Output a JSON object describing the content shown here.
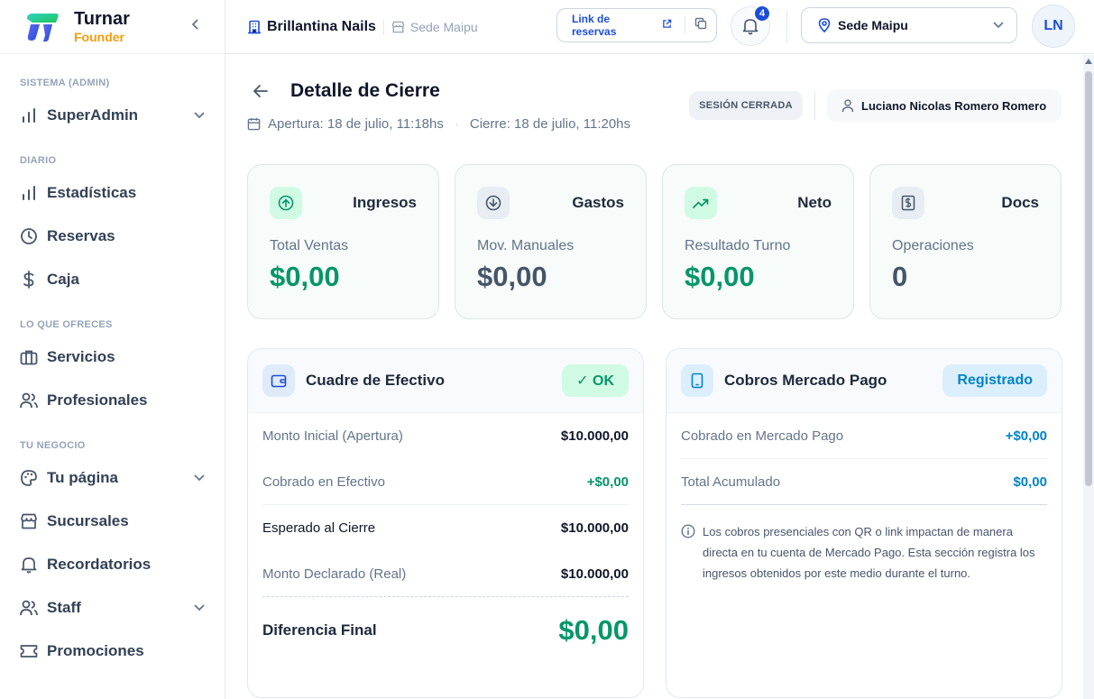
{
  "brand": {
    "name": "Turnar",
    "role": "Founder"
  },
  "sidebar": {
    "sections": [
      {
        "title": "SISTEMA (ADMIN)",
        "items": [
          {
            "label": "SuperAdmin",
            "icon": "bar-chart-icon",
            "expandable": true
          }
        ]
      },
      {
        "title": "DIARIO",
        "items": [
          {
            "label": "Estadísticas",
            "icon": "bar-chart-icon"
          },
          {
            "label": "Reservas",
            "icon": "clock-icon"
          },
          {
            "label": "Caja",
            "icon": "dollar-icon"
          }
        ]
      },
      {
        "title": "LO QUE OFRECES",
        "items": [
          {
            "label": "Servicios",
            "icon": "briefcase-icon"
          },
          {
            "label": "Profesionales",
            "icon": "users-icon"
          }
        ]
      },
      {
        "title": "TU NEGOCIO",
        "items": [
          {
            "label": "Tu página",
            "icon": "palette-icon",
            "expandable": true
          },
          {
            "label": "Sucursales",
            "icon": "store-icon"
          },
          {
            "label": "Recordatorios",
            "icon": "bell-icon"
          },
          {
            "label": "Staff",
            "icon": "users-icon",
            "expandable": true
          },
          {
            "label": "Promociones",
            "icon": "ticket-icon"
          }
        ]
      }
    ]
  },
  "topbar": {
    "business": "Brillantina Nails",
    "branch": "Sede Maipu",
    "booking_link": "Link de reservas",
    "notifications": "4",
    "selected_branch": "Sede Maipu",
    "avatar": "LN"
  },
  "page": {
    "title": "Detalle de Cierre",
    "opening": "Apertura: 18 de julio, 11:18hs",
    "closing": "Cierre: 18 de julio, 11:20hs",
    "status": "SESIÓN CERRADA",
    "user": "Luciano Nicolas Romero Romero"
  },
  "stats": [
    {
      "name": "Ingresos",
      "label": "Total Ventas",
      "value": "$0,00",
      "icon": "arrow-up-circle-icon",
      "color": "#059669"
    },
    {
      "name": "Gastos",
      "label": "Mov. Manuales",
      "value": "$0,00",
      "icon": "arrow-down-circle-icon",
      "color": "#475569"
    },
    {
      "name": "Neto",
      "label": "Resultado Turno",
      "value": "$0,00",
      "icon": "trending-up-icon",
      "color": "#059669"
    },
    {
      "name": "Docs",
      "label": "Operaciones",
      "value": "0",
      "icon": "receipt-icon",
      "color": "#475569"
    }
  ],
  "cash": {
    "title": "Cuadre de Efectivo",
    "tag": "✓ OK",
    "rows": [
      {
        "label": "Monto Inicial (Apertura)",
        "value": "$10.000,00"
      },
      {
        "label": "Cobrado en Efectivo",
        "value": "+$0,00"
      },
      {
        "label": "Esperado al Cierre",
        "value": "$10.000,00"
      },
      {
        "label": "Monto Declarado (Real)",
        "value": "$10.000,00"
      }
    ],
    "final_label": "Diferencia Final",
    "final_value": "$0,00"
  },
  "mp": {
    "title": "Cobros Mercado Pago",
    "tag": "Registrado",
    "rows": [
      {
        "label": "Cobrado en Mercado Pago",
        "value": "+$0,00"
      },
      {
        "label": "Total Acumulado",
        "value": "$0,00"
      }
    ],
    "note": "Los cobros presenciales con QR o link impactan de manera directa en tu cuenta de Mercado Pago. Esta sección registra los ingresos obtenidos por este medio durante el turno."
  }
}
